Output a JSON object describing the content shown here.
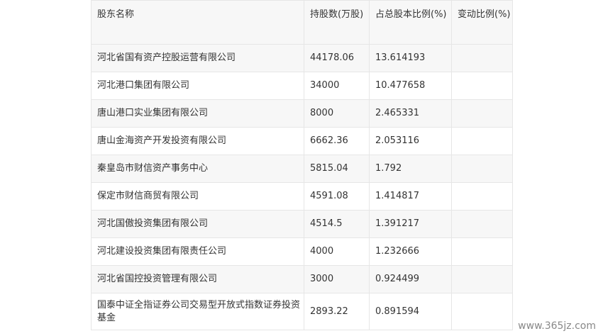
{
  "table": {
    "headers": {
      "name": "股东名称",
      "shares": "持股数(万股)",
      "pct": "占总股本比例(%)",
      "change": "变动比例(%)"
    },
    "rows": [
      {
        "name": "河北省国有资产控股运营有限公司",
        "shares": "44178.06",
        "pct": "13.614193",
        "change": ""
      },
      {
        "name": "河北港口集团有限公司",
        "shares": "34000",
        "pct": "10.477658",
        "change": ""
      },
      {
        "name": "唐山港口实业集团有限公司",
        "shares": "8000",
        "pct": "2.465331",
        "change": ""
      },
      {
        "name": "唐山金海资产开发投资有限公司",
        "shares": "6662.36",
        "pct": "2.053116",
        "change": ""
      },
      {
        "name": "秦皇岛市财信资产事务中心",
        "shares": "5815.04",
        "pct": "1.792",
        "change": ""
      },
      {
        "name": "保定市财信商贸有限公司",
        "shares": "4591.08",
        "pct": "1.414817",
        "change": ""
      },
      {
        "name": "河北国傲投资集团有限公司",
        "shares": "4514.5",
        "pct": "1.391217",
        "change": ""
      },
      {
        "name": "河北建设投资集团有限责任公司",
        "shares": "4000",
        "pct": "1.232666",
        "change": ""
      },
      {
        "name": "河北省国控投资管理有限公司",
        "shares": "3000",
        "pct": "0.924499",
        "change": ""
      },
      {
        "name": "国泰中证全指证券公司交易型开放式指数证券投资基金",
        "shares": "2893.22",
        "pct": "0.891594",
        "change": ""
      }
    ]
  },
  "watermark": "www.365jz.com"
}
